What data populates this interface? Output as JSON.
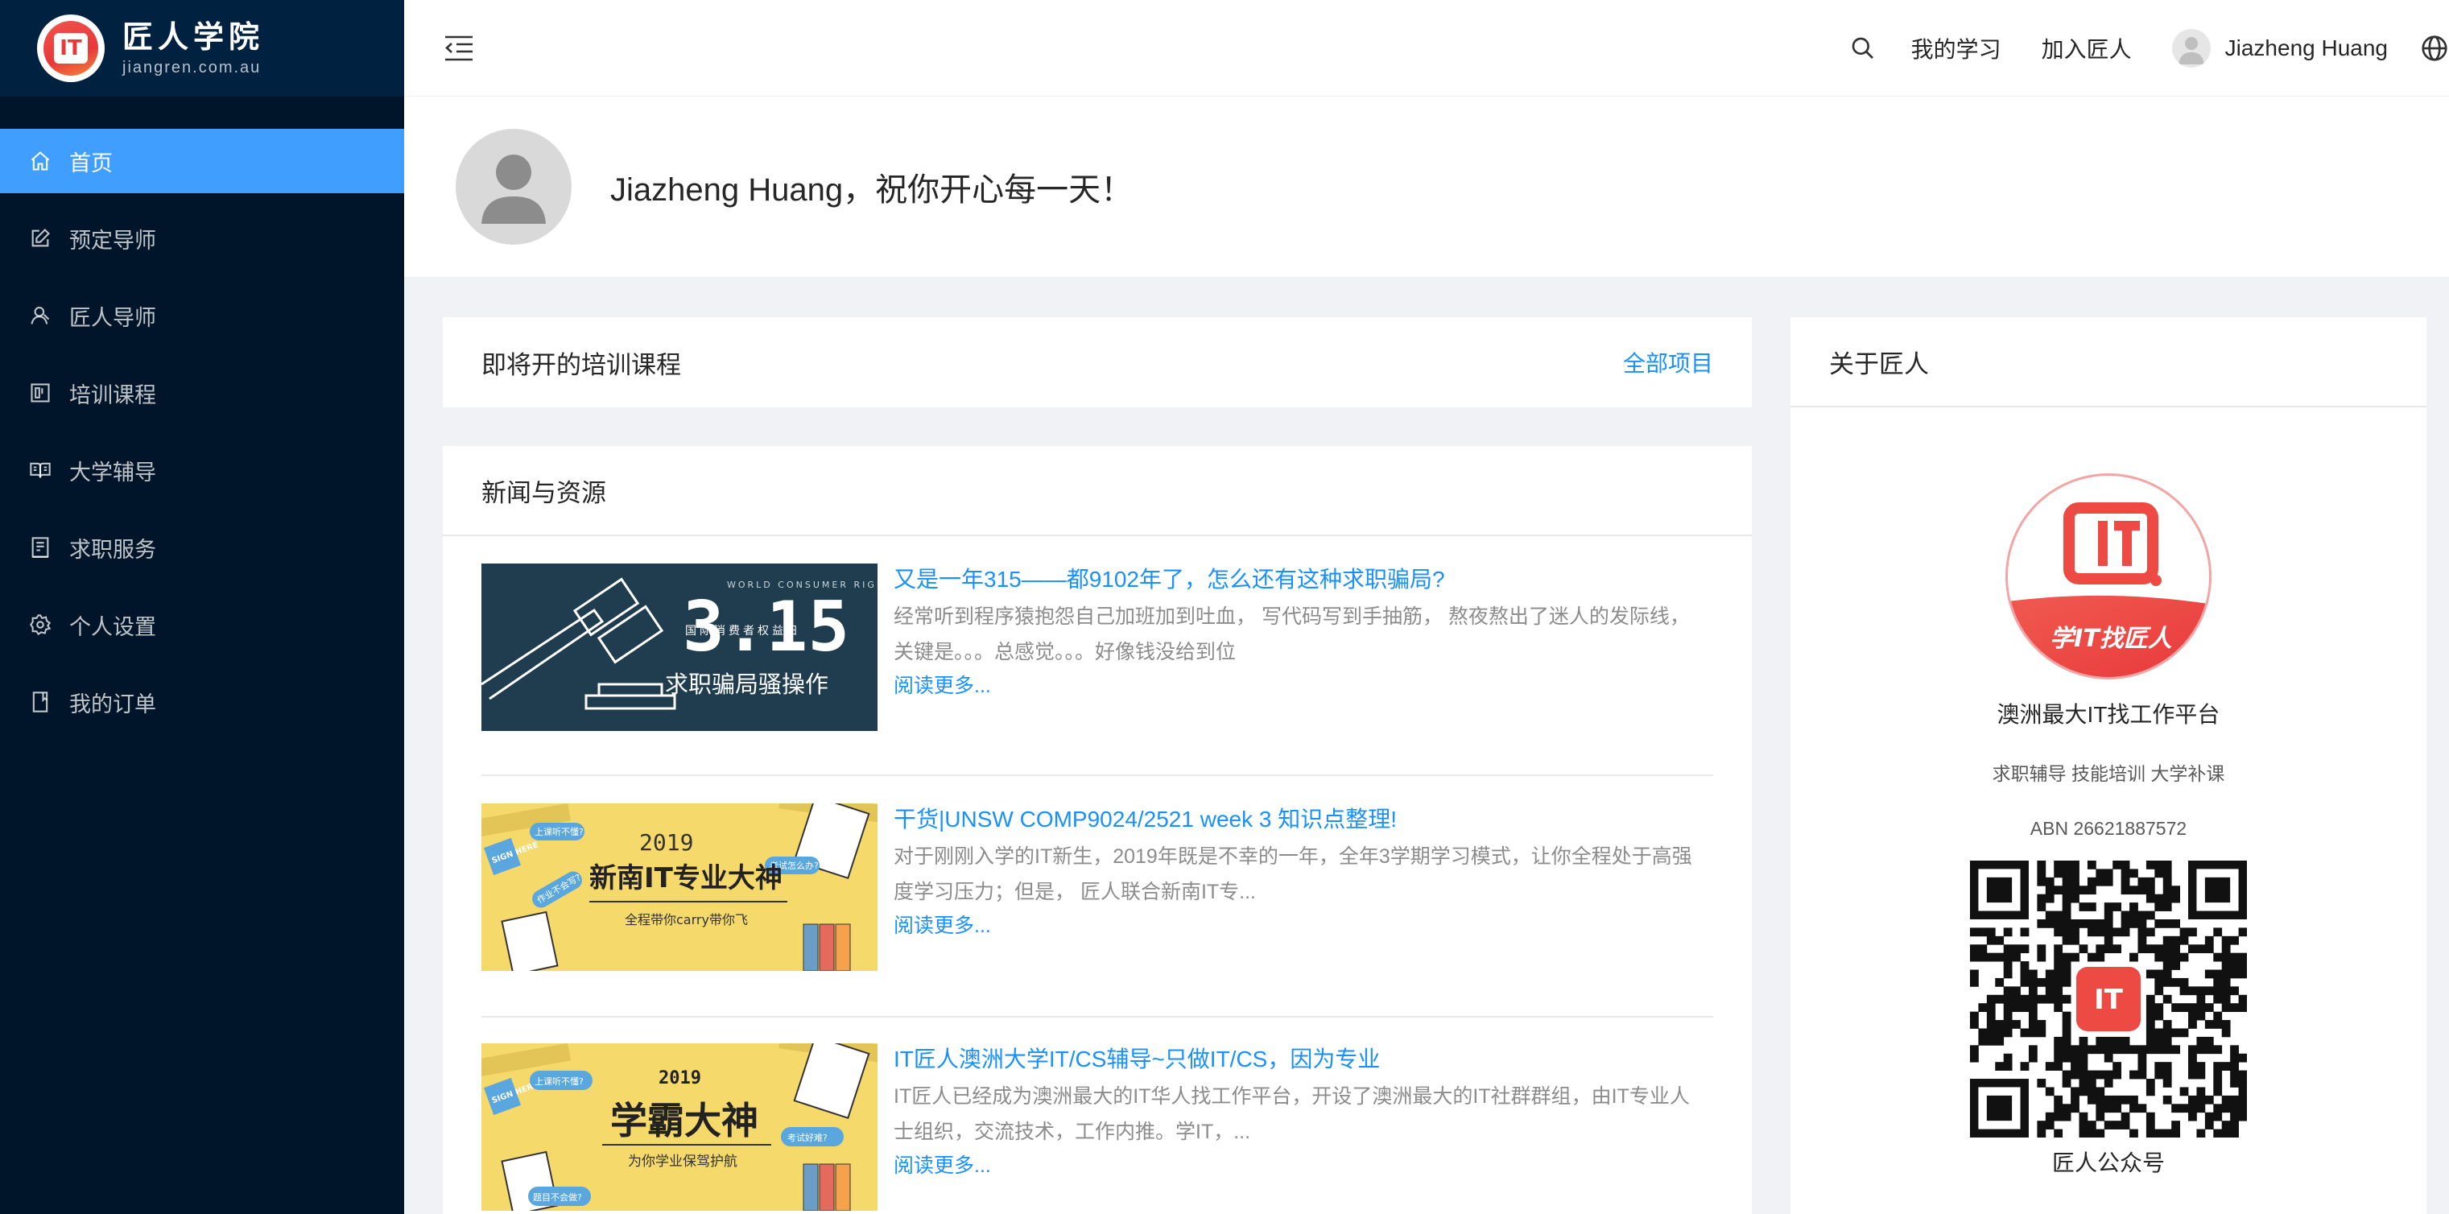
{
  "sidebar": {
    "logo_title": "匠人学院",
    "logo_sub": "jiangren.com.au",
    "logo_glyph": "IT",
    "items": [
      {
        "label": "首页",
        "icon": "home-icon",
        "active": true
      },
      {
        "label": "预定导师",
        "icon": "edit-icon"
      },
      {
        "label": "匠人导师",
        "icon": "user-icon"
      },
      {
        "label": "培训课程",
        "icon": "course-icon"
      },
      {
        "label": "大学辅导",
        "icon": "book-icon"
      },
      {
        "label": "求职服务",
        "icon": "job-icon"
      },
      {
        "label": "个人设置",
        "icon": "gear-icon"
      },
      {
        "label": "我的订单",
        "icon": "order-icon"
      }
    ]
  },
  "header": {
    "my_learning": "我的学习",
    "join": "加入匠人",
    "username": "Jiazheng Huang"
  },
  "welcome": {
    "text": "Jiazheng Huang，祝你开心每一天！"
  },
  "upcoming": {
    "title": "即将开的培训课程",
    "more": "全部项目"
  },
  "news": {
    "title": "新闻与资源",
    "read_more": "阅读更多...",
    "items": [
      {
        "title": "又是一年315——都9102年了，怎么还有这种求职骗局?",
        "desc": "经常听到程序猿抱怨自己加班加到吐血， 写代码写到手抽筋， 熬夜熬出了迷人的发际线， 关键是。。。总感觉。。。好像钱没给到位",
        "img_top": "WORLD CONSUMER RIGHTS DAY",
        "img_big": "3.15",
        "img_small": "国际消费者权益日",
        "img_caption": "求职骗局骚操作"
      },
      {
        "title": "干货|UNSW COMP9024/2521 week 3 知识点整理!",
        "desc": "对于刚刚入学的IT新生，2019年既是不幸的一年，全年3学期学习模式，让你全程处于高强度学习压力；但是， 匠人联合新南IT专...",
        "img_year": "2019",
        "img_title": "新南IT专业大神",
        "img_sub": "全程带你carry带你飞",
        "bubble_1": "上课听不懂?",
        "bubble_2": "考试怎么办?",
        "bubble_3": "作业不会写?",
        "stamp": "SIGN HERE"
      },
      {
        "title": "IT匠人澳洲大学IT/CS辅导~只做IT/CS，因为专业",
        "desc": "IT匠人已经成为澳洲最大的IT华人找工作平台，开设了澳洲最大的IT社群群组，由IT专业人士组织，交流技术，工作内推。学IT，...",
        "img_year": "2019",
        "img_title": "学霸大神",
        "img_sub": "为你学业保驾护航",
        "bubble_1": "上课听不懂?",
        "bubble_2": "考试好难?",
        "bubble_3": "题目不会做?",
        "stamp": "SIGN HERE"
      }
    ]
  },
  "about": {
    "title": "关于匠人",
    "logo_glyph": "IT",
    "logo_banner": "学IT找匠人",
    "tagline": "澳洲最大IT找工作平台",
    "services": "求职辅导 技能培训 大学补课",
    "abn": "ABN 26621887572",
    "qr_caption": "匠人公众号"
  }
}
